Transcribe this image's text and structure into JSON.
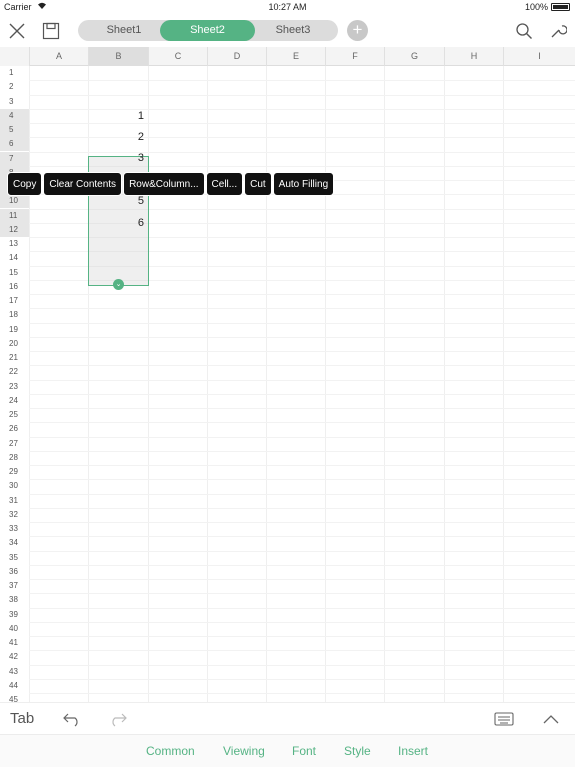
{
  "status_bar": {
    "carrier": "Carrier",
    "time": "10:27 AM",
    "battery": "100%"
  },
  "toolbar": {
    "tabs": [
      {
        "label": "Sheet1",
        "active": false
      },
      {
        "label": "Sheet2",
        "active": true
      },
      {
        "label": "Sheet3",
        "active": false
      }
    ],
    "accent": "#55b384"
  },
  "columns": [
    "A",
    "B",
    "C",
    "D",
    "E",
    "F",
    "G",
    "H",
    "I"
  ],
  "rows": [
    "1",
    "2",
    "3",
    "4",
    "5",
    "6",
    "7",
    "8",
    "9",
    "10",
    "11",
    "12",
    "13",
    "14",
    "15",
    "16",
    "17",
    "18",
    "19",
    "20",
    "21",
    "22",
    "23",
    "24",
    "25",
    "26",
    "27",
    "28",
    "29",
    "30",
    "31",
    "32",
    "33",
    "34",
    "35",
    "36",
    "37",
    "38",
    "39",
    "40",
    "41",
    "42",
    "43",
    "44",
    "45"
  ],
  "cells": {
    "B4": "1",
    "B5": "2",
    "B6": "3",
    "B8": "5",
    "B9": "6"
  },
  "context_menu": [
    "Copy",
    "Clear Contents",
    "Row&Column...",
    "Cell...",
    "Cut",
    "Auto Filling"
  ],
  "bottom_bar": {
    "tab_label": "Tab"
  },
  "menu_bar": [
    "Common",
    "Viewing",
    "Font",
    "Style",
    "Insert"
  ]
}
